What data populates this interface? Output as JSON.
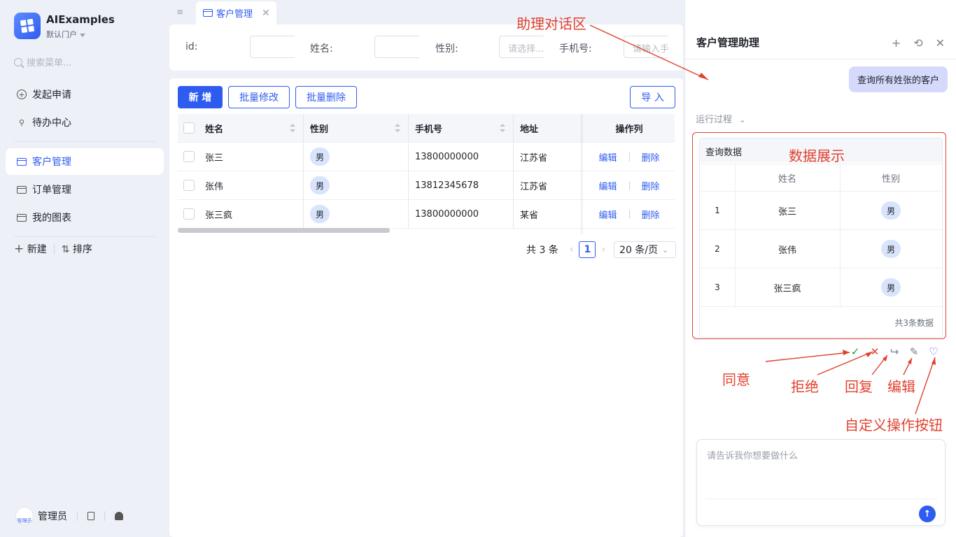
{
  "app": {
    "name": "AIExamples",
    "portal": "默认门户",
    "search_placeholder": "搜索菜单..."
  },
  "sidebar": {
    "items": [
      {
        "label": "发起申请",
        "icon": "plus-circle-icon"
      },
      {
        "label": "待办中心",
        "icon": "stamp-icon"
      },
      {
        "label": "客户管理",
        "icon": "window-icon",
        "active": true
      },
      {
        "label": "订单管理",
        "icon": "window-icon"
      },
      {
        "label": "我的图表",
        "icon": "window-icon"
      }
    ],
    "new_label": "新建",
    "sort_label": "排序",
    "user_name": "管理员",
    "avatar_text": "管理员"
  },
  "tabs": [
    {
      "label": "客户管理",
      "active": true
    }
  ],
  "filters": [
    {
      "label": "id:",
      "placeholder": ""
    },
    {
      "label": "姓名:",
      "placeholder": ""
    },
    {
      "label": "性别:",
      "placeholder": "请选择..."
    },
    {
      "label": "手机号:",
      "placeholder": "请输入手机号"
    }
  ],
  "toolbar": {
    "add_label": "新 增",
    "batch_edit_label": "批量修改",
    "batch_delete_label": "批量删除",
    "import_label": "导 入"
  },
  "table": {
    "columns": [
      "姓名",
      "性别",
      "手机号",
      "地址",
      "操作列"
    ],
    "rows": [
      {
        "name": "张三",
        "gender": "男",
        "phone": "13800000000",
        "address": "江苏省"
      },
      {
        "name": "张伟",
        "gender": "男",
        "phone": "13812345678",
        "address": "江苏省"
      },
      {
        "name": "张三疯",
        "gender": "男",
        "phone": "13800000000",
        "address": "某省"
      }
    ],
    "edit_label": "编辑",
    "delete_label": "删除"
  },
  "pagination": {
    "total_label": "共 3 条",
    "current_page": "1",
    "page_size": "20 条/页"
  },
  "assistant": {
    "title": "客户管理助理",
    "user_message": "查询所有姓张的客户",
    "process_label": "运行过程",
    "result_title": "查询数据",
    "result_columns": [
      "姓名",
      "性别"
    ],
    "result_rows": [
      {
        "index": "1",
        "name": "张三",
        "gender": "男"
      },
      {
        "index": "2",
        "name": "张伟",
        "gender": "男"
      },
      {
        "index": "3",
        "name": "张三疯",
        "gender": "男"
      }
    ],
    "result_footer": "共3条数据",
    "input_placeholder": "请告诉我你想要做什么"
  },
  "annotations": {
    "chat_area": "助理对话区",
    "data_display": "数据展示",
    "agree": "同意",
    "reject": "拒绝",
    "reply": "回复",
    "edit": "编辑",
    "custom_button": "自定义操作按钮"
  },
  "colors": {
    "primary": "#2f5cf0",
    "annotation": "#e0412f",
    "approve": "#1f9d3a",
    "reject": "#e0412f"
  }
}
